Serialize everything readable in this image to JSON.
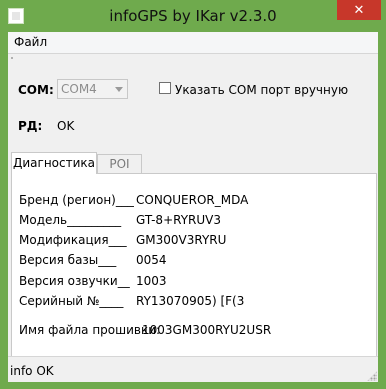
{
  "window": {
    "title": "infoGPS  by IKar v2.3.0",
    "close_symbol": "✕"
  },
  "menu": {
    "file_label": "Файл"
  },
  "connection": {
    "com_label": "COM:",
    "com_value": "COM4",
    "manual_checkbox_label": "Указать COM  порт вручную",
    "manual_checked": false,
    "rd_label": "РД:",
    "rd_value": "OK"
  },
  "tabs": [
    {
      "label": "Диагностика",
      "active": true
    },
    {
      "label": "POI",
      "active": false
    }
  ],
  "diagnostics": {
    "rows": [
      {
        "label": "Бренд (регион)___",
        "value": "CONQUEROR_MDA"
      },
      {
        "label": "Модель_________",
        "value": "GT-8+RYRUV3"
      },
      {
        "label": "Модификация___",
        "value": "GM300V3RYRU"
      },
      {
        "label": "Версия базы___",
        "value": "0054"
      },
      {
        "label": "Версия озвучки__",
        "value": "1003"
      },
      {
        "label": "Серийный №____",
        "value": "RY13070905) [F(3"
      }
    ],
    "firmware_label": "Имя файла прошивки:",
    "firmware_value": "1003GM300RYU2USR"
  },
  "status": {
    "text": "info OK"
  },
  "colors": {
    "titlebar": "#6faa4d",
    "close": "#c7372a"
  }
}
